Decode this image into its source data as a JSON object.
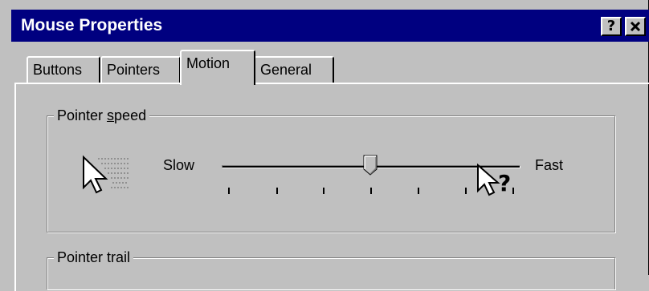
{
  "window": {
    "title": "Mouse Properties",
    "help_button": "?",
    "close_button": "✕"
  },
  "tabs": [
    {
      "label": "Buttons",
      "selected": false
    },
    {
      "label": "Pointers",
      "selected": false
    },
    {
      "label": "Motion",
      "selected": true
    },
    {
      "label": "General",
      "selected": false
    }
  ],
  "pointer_speed": {
    "title": "Pointer speed",
    "min_label": "Slow",
    "max_label": "Fast",
    "value_fraction": 0.5,
    "tick_count": 7,
    "icon": "fast-pointer-icon"
  },
  "pointer_trail": {
    "title": "Pointer trail"
  },
  "cursor": {
    "icon": "help-select-cursor-icon",
    "glyph": "?"
  }
}
